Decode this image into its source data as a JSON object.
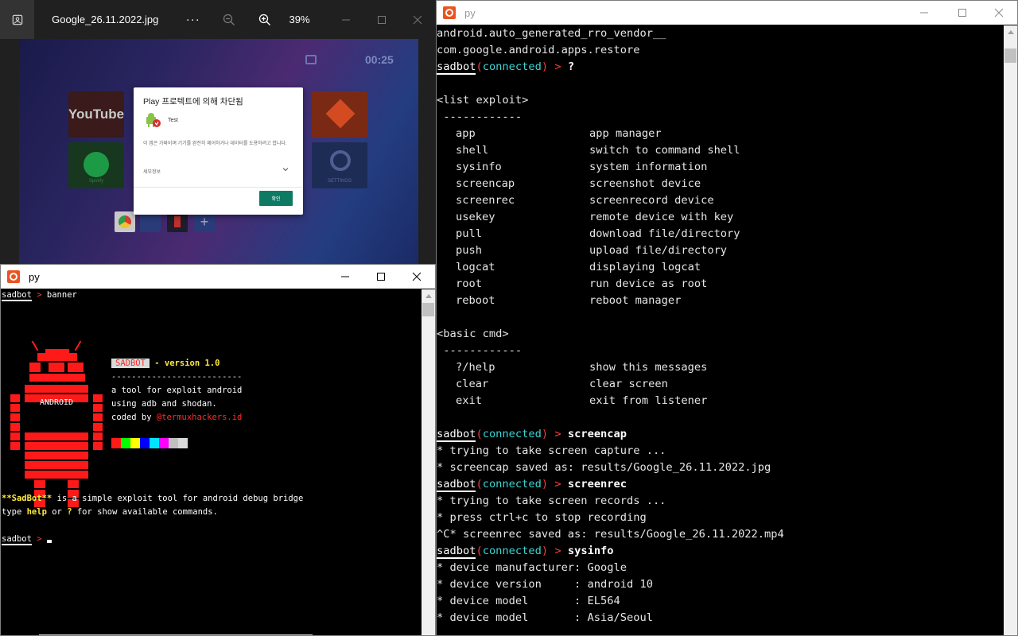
{
  "viewer": {
    "filename": "Google_26.11.2022.jpg",
    "more": "···",
    "zoom": "39%",
    "screenshot": {
      "clock": "00:25",
      "youtube_tile": "YouTube",
      "spotify_caption": "Spotify",
      "settings_caption": "SETTINGS",
      "dock_plus": "+"
    },
    "dialog": {
      "title": "Play 프로텍트에 의해 차단됨",
      "app_name": "Test",
      "message": "이 앱은 가짜이며 기기를 완전히 제어하거나 데이터를 도용하려고 합니다.",
      "details": "세부정보",
      "ok": "확인"
    }
  },
  "term_right": {
    "title": "py",
    "lines": {
      "l1": "android.auto_generated_rro_vendor__",
      "l2": "com.google.android.apps.restore",
      "list_header": "<list exploit>",
      "sep": " ------------",
      "basic_header": "<basic cmd>"
    },
    "prompt": {
      "name": "sadbot",
      "open": "(",
      "conn": "connected",
      "close": ")",
      "gt": " > "
    },
    "exploits": [
      {
        "cmd": "app",
        "desc": "app manager"
      },
      {
        "cmd": "shell",
        "desc": "switch to command shell"
      },
      {
        "cmd": "sysinfo",
        "desc": "system information"
      },
      {
        "cmd": "screencap",
        "desc": "screenshot device"
      },
      {
        "cmd": "screenrec",
        "desc": "screenrecord device"
      },
      {
        "cmd": "usekey",
        "desc": "remote device with key"
      },
      {
        "cmd": "pull",
        "desc": "download file/directory"
      },
      {
        "cmd": "push",
        "desc": "upload file/directory"
      },
      {
        "cmd": "logcat",
        "desc": "displaying logcat"
      },
      {
        "cmd": "root",
        "desc": "run device as root"
      },
      {
        "cmd": "reboot",
        "desc": "reboot manager"
      }
    ],
    "basic": [
      {
        "cmd": "?/help",
        "desc": "show this messages"
      },
      {
        "cmd": "clear",
        "desc": "clear screen"
      },
      {
        "cmd": "exit",
        "desc": "exit from listener"
      }
    ],
    "cmd_help": "?",
    "cmd_screencap": "screencap",
    "screencap_out": [
      "* trying to take screen capture ...",
      "* screencap saved as: results/Google_26.11.2022.jpg"
    ],
    "cmd_screenrec": "screenrec",
    "screenrec_out": [
      "* trying to take screen records ...",
      "* press ctrl+c to stop recording",
      "^C* screenrec saved as: results/Google_26.11.2022.mp4"
    ],
    "cmd_sysinfo": "sysinfo",
    "sysinfo_out": [
      "* device manufacturer: Google",
      "* device version     : android 10",
      "* device model       : EL564",
      "* device model       : Asia/Seoul"
    ]
  },
  "term_left": {
    "title": "py",
    "prompt_name": "sadbot",
    "gt": " > ",
    "cmd": "banner",
    "android_label": "ANDROID",
    "badge": "SADBOT",
    "version": " - version 1.0",
    "rule": "--------------------------",
    "desc1": "a tool for exploit android",
    "desc2": "using adb and shodan.",
    "coded_by": "coded by ",
    "author": "@termuxhackers.id",
    "about_name": "**SadBot**",
    "about_rest": " is a simple exploit tool for android debug bridge",
    "type_pre": "type ",
    "help": "help",
    "or": " or ",
    "q": "?",
    "type_post": " for show available commands.",
    "palette": [
      "#ff1a1a",
      "#00ff00",
      "#ffff00",
      "#0000ff",
      "#00e5ff",
      "#ff00ff",
      "#c0c0c0",
      "#d9d9d9"
    ]
  }
}
